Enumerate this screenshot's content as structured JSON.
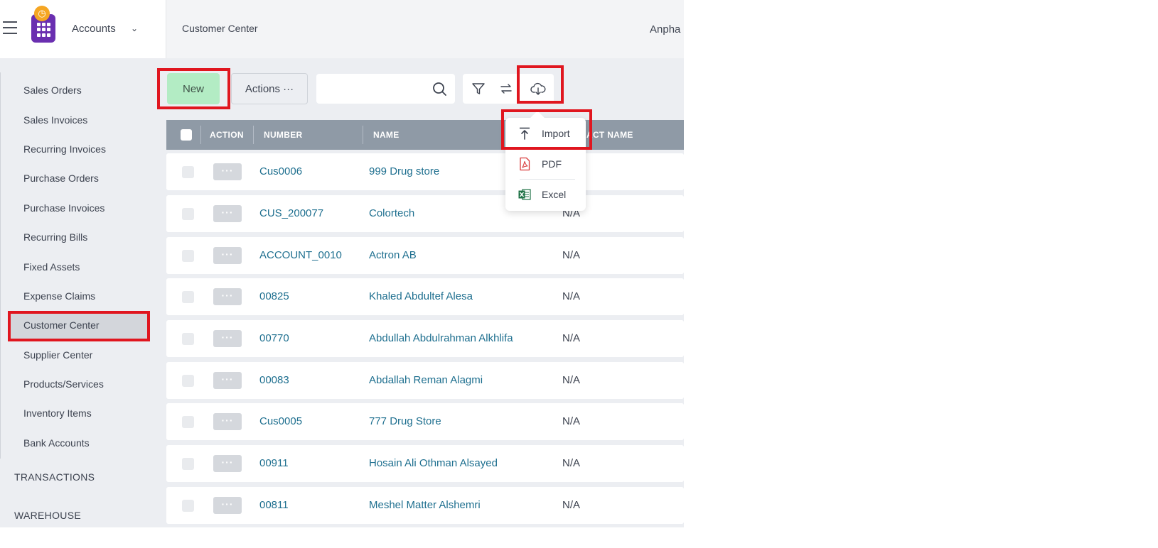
{
  "header": {
    "module_label": "Accounts",
    "breadcrumb": "Customer Center",
    "company_name": "Anpha"
  },
  "sidebar": {
    "items": [
      {
        "label": "Sales Orders"
      },
      {
        "label": "Sales Invoices"
      },
      {
        "label": "Recurring Invoices"
      },
      {
        "label": "Purchase Orders"
      },
      {
        "label": "Purchase Invoices"
      },
      {
        "label": "Recurring Bills"
      },
      {
        "label": "Fixed Assets"
      },
      {
        "label": "Expense Claims"
      },
      {
        "label": "Customer Center",
        "active": true
      },
      {
        "label": "Supplier Center"
      },
      {
        "label": "Products/Services"
      },
      {
        "label": "Inventory Items"
      },
      {
        "label": "Bank Accounts"
      }
    ],
    "sections": [
      {
        "label": "TRANSACTIONS"
      },
      {
        "label": "WAREHOUSE"
      }
    ]
  },
  "toolbar": {
    "new_label": "New",
    "actions_label": "Actions ···",
    "search_value": ""
  },
  "table": {
    "columns": [
      "ACTION",
      "NUMBER",
      "NAME",
      "ACT NAME"
    ],
    "rows": [
      {
        "number": "Cus0006",
        "name": "999 Drug store",
        "contact": ""
      },
      {
        "number": "CUS_200077",
        "name": "Colortech",
        "contact": "N/A"
      },
      {
        "number": "ACCOUNT_0010",
        "name": "Actron AB",
        "contact": "N/A"
      },
      {
        "number": "00825",
        "name": "Khaled Abdultef Alesa",
        "contact": "N/A"
      },
      {
        "number": "00770",
        "name": "Abdullah Abdulrahman Alkhlifa",
        "contact": "N/A"
      },
      {
        "number": "00083",
        "name": "Abdallah Reman Alagmi",
        "contact": "N/A"
      },
      {
        "number": "Cus0005",
        "name": "777 Drug Store",
        "contact": "N/A"
      },
      {
        "number": "00911",
        "name": "Hosain Ali Othman Alsayed",
        "contact": "N/A"
      },
      {
        "number": "00811",
        "name": "Meshel Matter Alshemri",
        "contact": "N/A"
      }
    ]
  },
  "export_menu": {
    "items": [
      {
        "label": "Import",
        "icon": "upload-icon"
      },
      {
        "label": "PDF",
        "icon": "pdf-icon"
      },
      {
        "label": "Excel",
        "icon": "excel-icon"
      }
    ]
  },
  "colors": {
    "new_button": "#b3ecc4",
    "link": "#1e6f8f",
    "table_header": "#8f9aa6",
    "highlight": "#e0161f",
    "active_nav": "#d3d6db"
  }
}
